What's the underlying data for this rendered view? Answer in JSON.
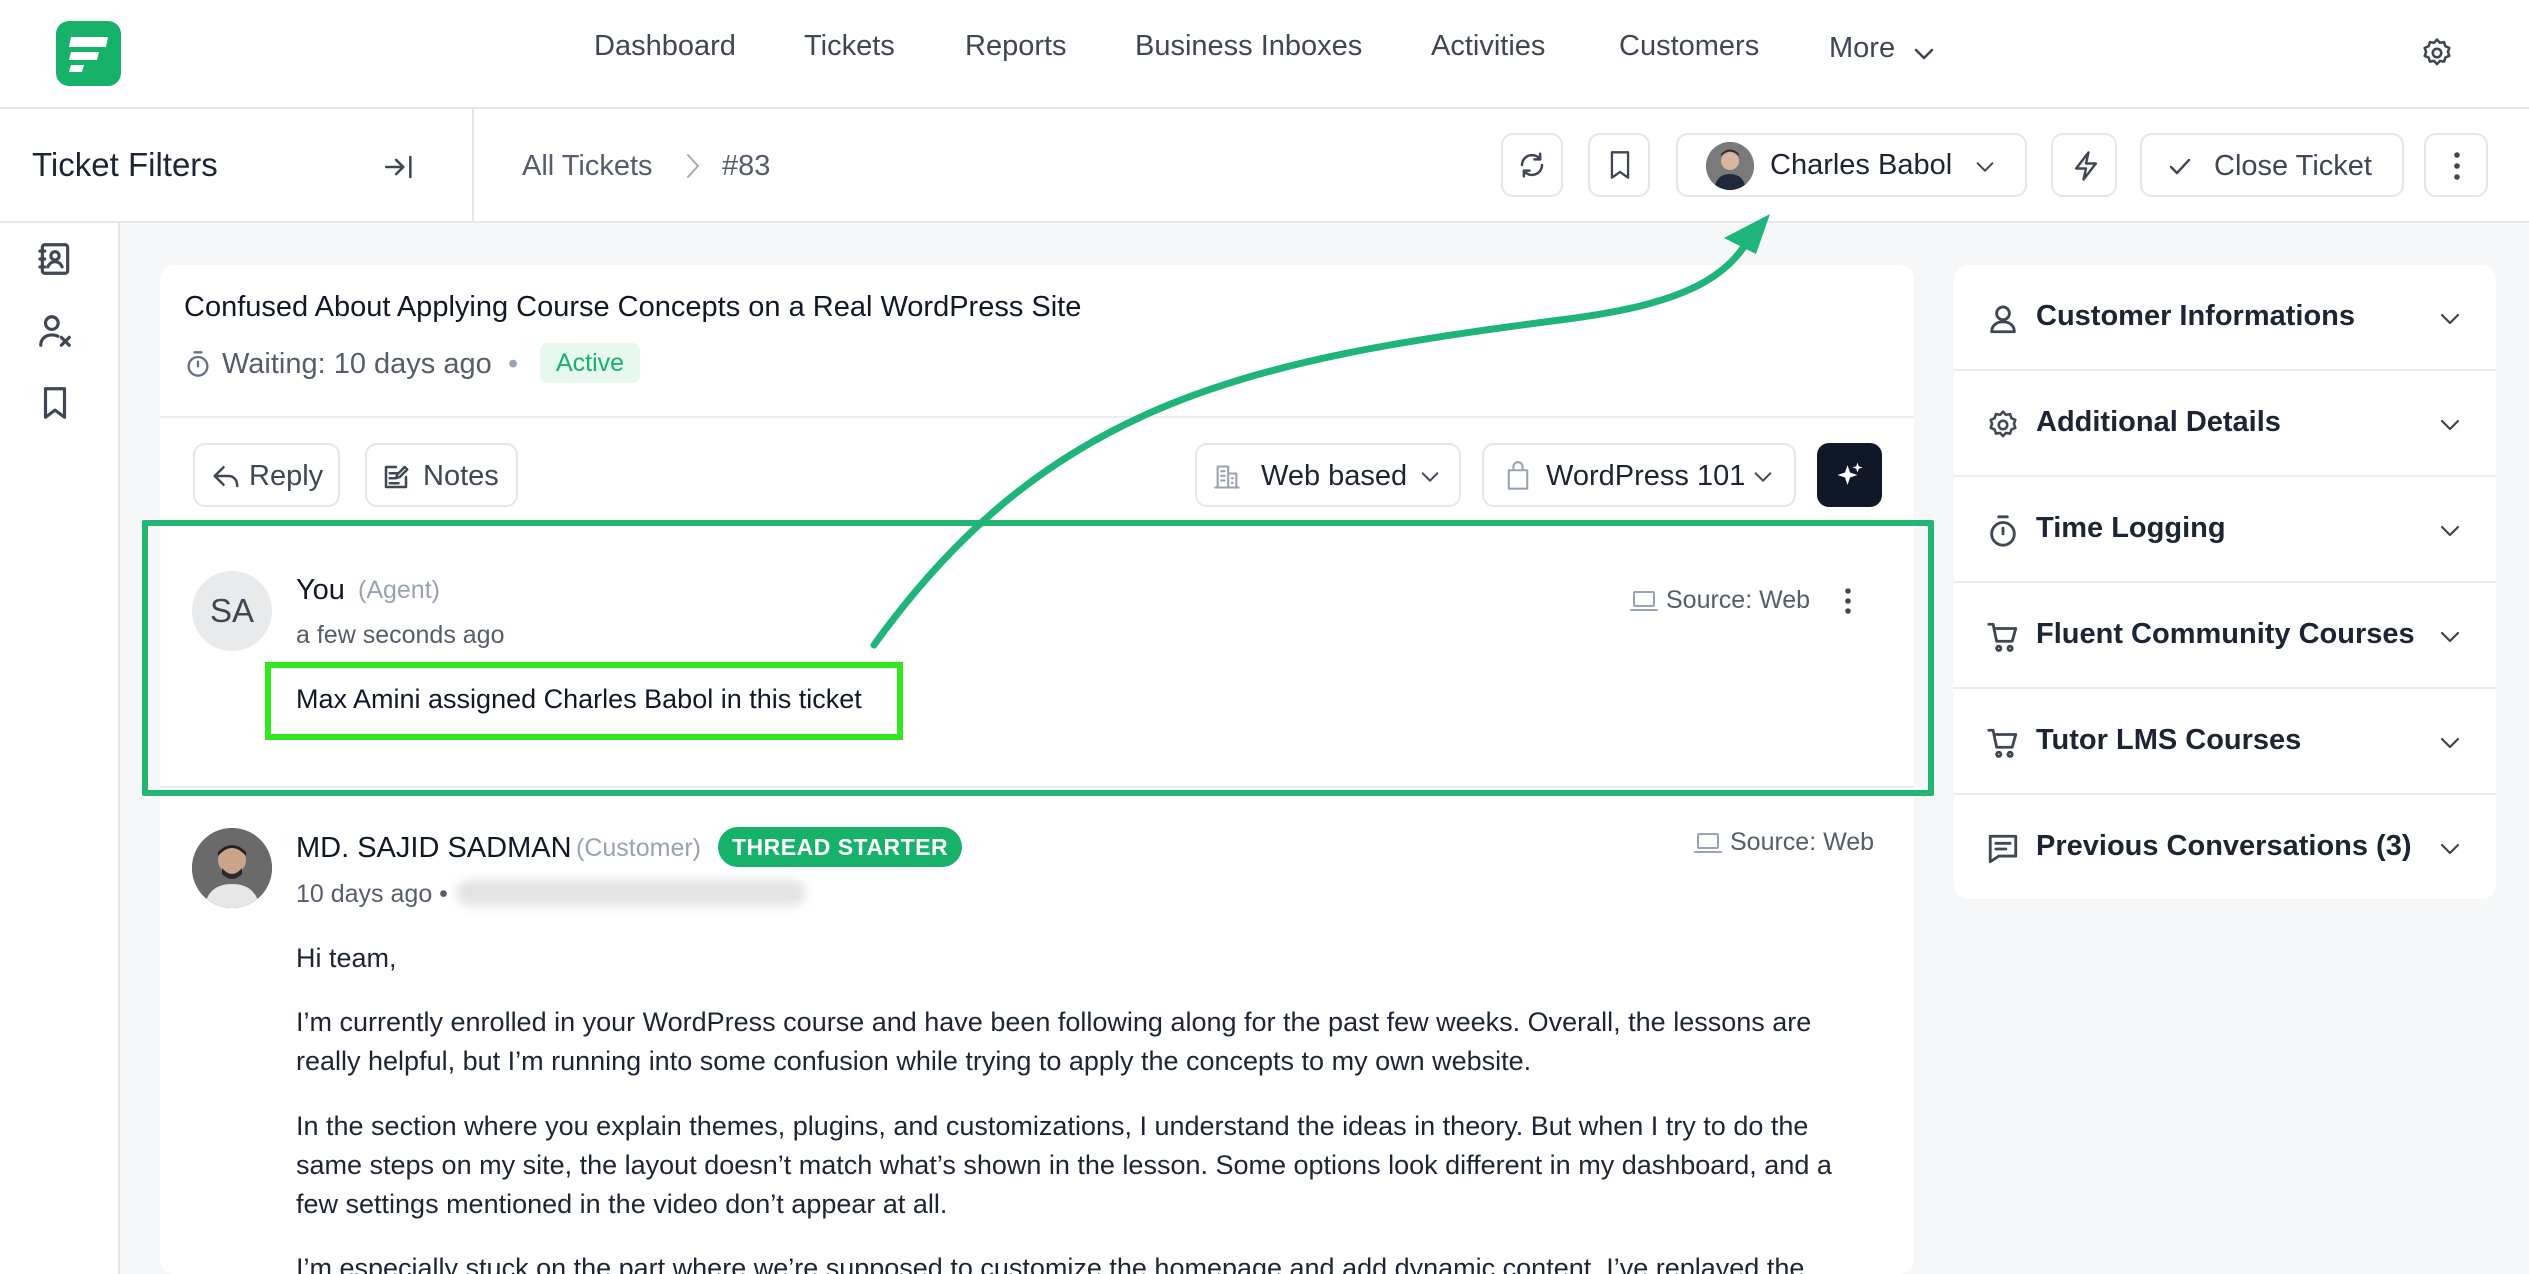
{
  "nav": {
    "items": [
      "Dashboard",
      "Tickets",
      "Reports",
      "Business Inboxes",
      "Activities",
      "Customers",
      "More"
    ]
  },
  "subheader": {
    "filters_title": "Ticket Filters",
    "breadcrumb": [
      "All Tickets",
      "#83"
    ],
    "assignee": "Charles Babol",
    "close_label": "Close Ticket"
  },
  "ticket": {
    "title": "Confused About Applying Course Concepts on a Real WordPress Site",
    "waiting": "Waiting: 10 days ago",
    "dot": "•",
    "status": "Active"
  },
  "toolbar": {
    "reply": "Reply",
    "notes": "Notes",
    "channel": "Web based",
    "product": "WordPress 101"
  },
  "agent_message": {
    "avatar_initials": "SA",
    "name": "You",
    "role": "(Agent)",
    "time": "a few seconds ago",
    "source": "Source: Web",
    "text": "Max Amini assigned Charles Babol in this ticket"
  },
  "customer_message": {
    "name": "MD. SAJID SADMAN",
    "role": "(Customer)",
    "badge": "THREAD STARTER",
    "time": "10 days ago •",
    "source": "Source: Web",
    "paragraphs": [
      "Hi team,",
      "I’m currently enrolled in your WordPress course and have been following along for the past few weeks. Overall, the lessons are really helpful, but I’m running into some confusion while trying to apply the concepts to my own website.",
      "In the section where you explain themes, plugins, and customizations, I understand the ideas in theory. But when I try to do the same steps on my site, the layout doesn’t match what’s shown in the lesson. Some options look different in my dashboard, and a few settings mentioned in the video don’t appear at all.",
      "I’m especially stuck on the part where we’re supposed to customize the homepage and add dynamic content. I’ve replayed the"
    ]
  },
  "sidebar_panels": [
    {
      "label": "Customer Informations",
      "icon": "user-icon"
    },
    {
      "label": "Additional Details",
      "icon": "gear-icon"
    },
    {
      "label": "Time Logging",
      "icon": "timer-icon"
    },
    {
      "label": "Fluent Community Courses",
      "icon": "cart-icon"
    },
    {
      "label": "Tutor LMS Courses",
      "icon": "cart-icon"
    },
    {
      "label": "Previous Conversations (3)",
      "icon": "chat-icon"
    }
  ],
  "colors": {
    "brand": "#17b26a",
    "highlight_outer": "#22b573",
    "highlight_inner": "#33e61e",
    "arrow": "#1fb57a"
  }
}
